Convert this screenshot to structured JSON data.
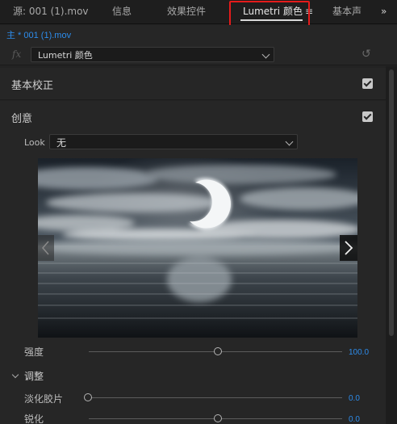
{
  "tabs": [
    {
      "label": "源: 001 (1).mov"
    },
    {
      "label": "信息"
    },
    {
      "label": "效果控件"
    },
    {
      "label": "Lumetri 颜色"
    },
    {
      "label": "基本声"
    }
  ],
  "active_tab": "Lumetri 颜色",
  "tab_menu_glyph": "≡",
  "tab_more_glyph": "»",
  "clip": {
    "label": "主 * 001 (1).mov"
  },
  "effect": {
    "fx_glyph": "fx",
    "selected": "Lumetri 颜色",
    "reset_glyph": "↺"
  },
  "sections": {
    "basic": {
      "title": "基本校正",
      "checked": true
    },
    "creative": {
      "title": "创意",
      "checked": true
    }
  },
  "look": {
    "label": "Look",
    "value": "无"
  },
  "sliders": {
    "intensity": {
      "label": "强度",
      "value": "100.0",
      "fraction": 0.5
    },
    "faded_film": {
      "label": "淡化胶片",
      "value": "0.0",
      "fraction": 0.0
    },
    "sharpen": {
      "label": "锐化",
      "value": "0.0",
      "fraction": 0.5
    }
  },
  "adjust": {
    "title": "调整"
  },
  "colors": {
    "accent": "#2d8ceb",
    "highlight": "#e51b1b",
    "panel": "#262626"
  }
}
